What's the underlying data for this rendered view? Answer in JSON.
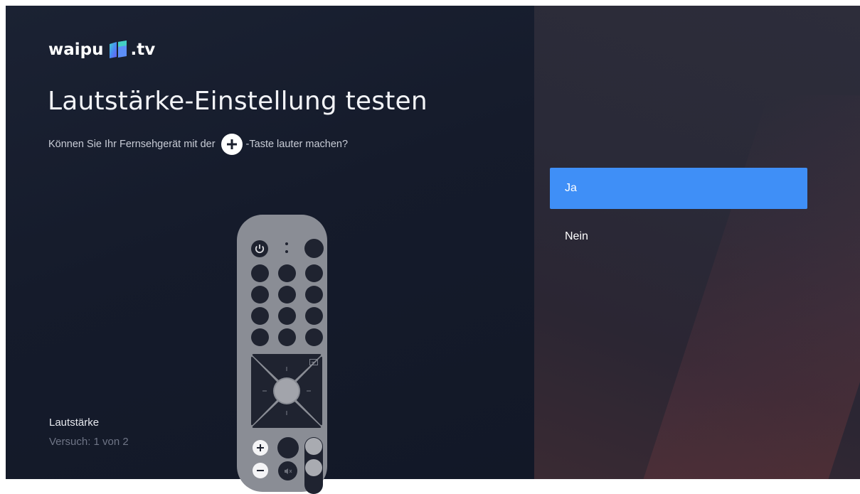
{
  "brand": {
    "name_left": "waipu",
    "name_right": ".tv",
    "logo_icon": "waipu-logo-icon"
  },
  "page": {
    "title": "Lautstärke-Einstellung testen",
    "question_before": "Können Sie Ihr Fernsehgerät mit der",
    "question_after": "-Taste lauter machen?",
    "question_icon": "plus-circle-icon"
  },
  "status": {
    "label": "Lautstärke",
    "attempt": "Versuch: 1 von 2"
  },
  "options": [
    {
      "label": "Ja",
      "selected": true
    },
    {
      "label": "Nein",
      "selected": false
    }
  ],
  "remote": {
    "icons": [
      "power-icon",
      "dpad-icon",
      "input-icon",
      "volume-plus-icon",
      "volume-minus-icon",
      "mute-icon"
    ],
    "highlight_button": "volume-plus"
  },
  "colors": {
    "accent": "#3f8ff7",
    "left_background": "#161c2b",
    "right_background": "#2b2a37",
    "remote_body": "#8a8d95"
  }
}
